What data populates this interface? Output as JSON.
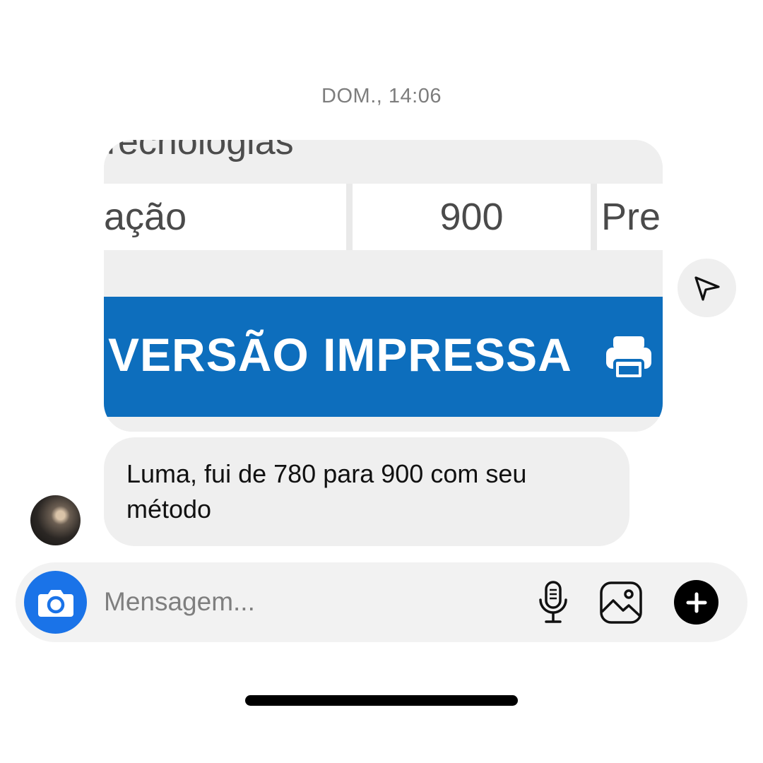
{
  "chat": {
    "timestamp": "DOM., 14:06"
  },
  "shared_image": {
    "top_text": "Tecnologias",
    "row": [
      "ação",
      "900",
      "Pre"
    ],
    "banner_text": "VERSÃO IMPRESSA",
    "banner_color": "#0d6ebd",
    "banner_icon": "printer-icon"
  },
  "message": {
    "text": "Luma, fui de 780 para 900 com seu método"
  },
  "composer": {
    "placeholder": "Mensagem...",
    "accent_color": "#1a73e8",
    "icons": [
      "camera-icon",
      "microphone-icon",
      "gallery-icon",
      "plus-icon"
    ]
  },
  "share_icon": "send-icon"
}
